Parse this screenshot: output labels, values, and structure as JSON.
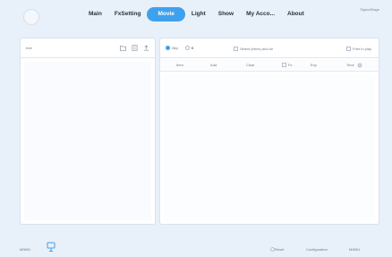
{
  "nav": {
    "items": [
      "Main",
      "FxSetting",
      "Movie",
      "Light",
      "Show",
      "My Acco...",
      "About"
    ],
    "active_index": 2
  },
  "user": {
    "name": "SigmaStage"
  },
  "tree_panel": {
    "label": "tree",
    "icons": [
      "folder-icon",
      "file-icon",
      "upload-icon"
    ]
  },
  "content_panel": {
    "options": [
      {
        "label": "Grp",
        "selected": true
      },
      {
        "label": "B",
        "selected": false
      }
    ],
    "checkbox_center": {
      "label": "Select (trees) and all",
      "checked": false
    },
    "checkbox_right": {
      "label": "Free in play",
      "checked": false
    },
    "columns": [
      "Item",
      "Add",
      "Clear",
      "Fx",
      "Exp",
      "Time"
    ]
  },
  "status": {
    "left_text": "M9651",
    "right_items": [
      "Reset",
      "Configuration",
      "M9651"
    ]
  },
  "colors": {
    "accent": "#3fa1ee",
    "background": "#e8f0f9",
    "panel": "#ffffff"
  }
}
